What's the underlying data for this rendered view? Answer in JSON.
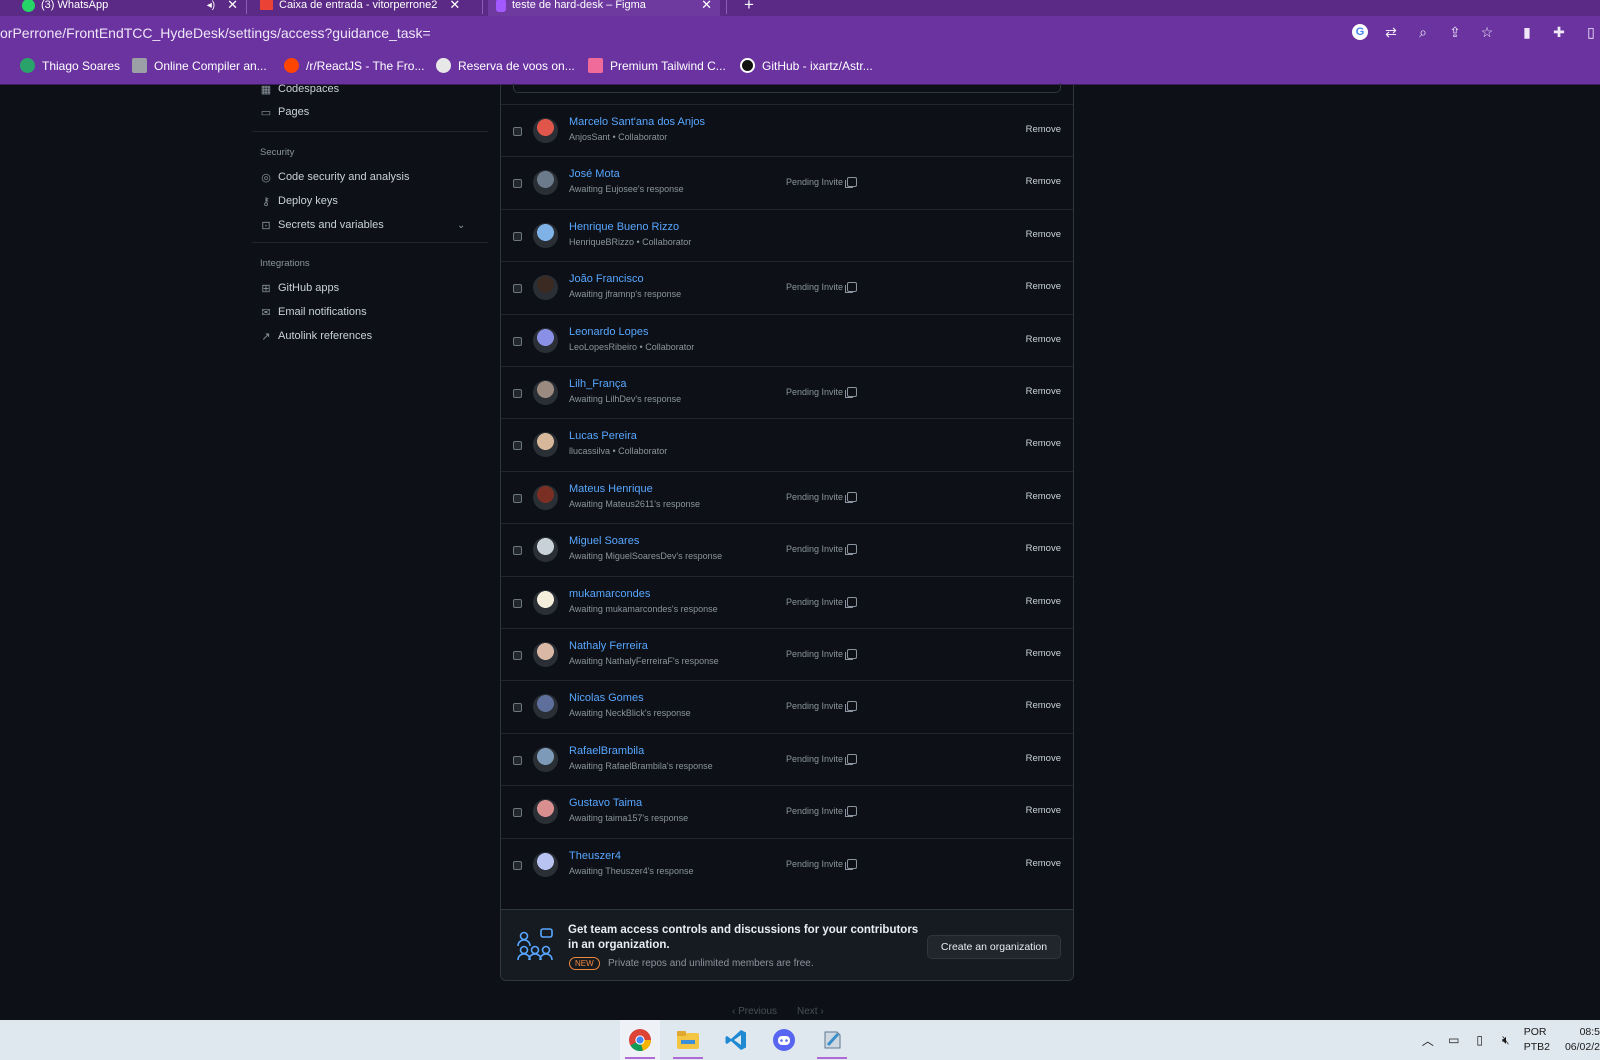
{
  "browser": {
    "tabs": [
      {
        "title": "(3) WhatsApp"
      },
      {
        "title": "Caixa de entrada - vitorperrone2"
      },
      {
        "title": "teste de hard-desk – Figma"
      }
    ],
    "url": "orPerrone/FrontEndTCC_HydeDesk/settings/access?guidance_task=",
    "bookmarks": [
      {
        "label": "Thiago Soares",
        "color": "#2aa36b"
      },
      {
        "label": "Online Compiler an...",
        "color": "#9aa0a6"
      },
      {
        "label": "/r/ReactJS - The Fro...",
        "color": "#ff4500"
      },
      {
        "label": "Reserva de voos on...",
        "color": "#e8e8e8"
      },
      {
        "label": "Premium Tailwind C...",
        "color": "#f06a9a"
      },
      {
        "label": "GitHub - ixartz/Astr...",
        "color": "#111111"
      }
    ]
  },
  "sidebar": {
    "top_items": [
      {
        "label": "Codespaces",
        "icon": "codespaces-icon"
      },
      {
        "label": "Pages",
        "icon": "browser-icon"
      }
    ],
    "security_heading": "Security",
    "security_items": [
      {
        "label": "Code security and analysis",
        "icon": "codescan-icon"
      },
      {
        "label": "Deploy keys",
        "icon": "key-icon"
      },
      {
        "label": "Secrets and variables",
        "icon": "asterisk-icon"
      }
    ],
    "integrations_heading": "Integrations",
    "integration_items": [
      {
        "label": "GitHub apps",
        "icon": "apps-icon"
      },
      {
        "label": "Email notifications",
        "icon": "mail-icon"
      },
      {
        "label": "Autolink references",
        "icon": "link-external-icon"
      }
    ]
  },
  "collaborators": {
    "pending_label": "Pending Invite",
    "remove_label": "Remove",
    "rows": [
      {
        "name": "Marcelo Sant'ana dos Anjos",
        "sub": "AnjosSant • Collaborator",
        "pending": false,
        "avatar": "#e0564a"
      },
      {
        "name": "José Mota",
        "sub": "Awaiting Eujosee's response",
        "pending": true,
        "avatar": "#6b7b8c"
      },
      {
        "name": "Henrique Bueno Rizzo",
        "sub": "HenriqueBRizzo • Collaborator",
        "pending": false,
        "avatar": "#7fb3e8"
      },
      {
        "name": "João Francisco",
        "sub": "Awaiting jframnp's response",
        "pending": true,
        "avatar": "#3a2a22"
      },
      {
        "name": "Leonardo Lopes",
        "sub": "LeoLopesRibeiro • Collaborator",
        "pending": false,
        "avatar": "#8a90e6"
      },
      {
        "name": "Lilh_França",
        "sub": "Awaiting LilhDev's response",
        "pending": true,
        "avatar": "#9a8a80"
      },
      {
        "name": "Lucas Pereira",
        "sub": "llucassilva • Collaborator",
        "pending": false,
        "avatar": "#d8b89a"
      },
      {
        "name": "Mateus Henrique",
        "sub": "Awaiting Mateus2611's response",
        "pending": true,
        "avatar": "#7a2f22"
      },
      {
        "name": "Miguel Soares",
        "sub": "Awaiting MiguelSoaresDev's response",
        "pending": true,
        "avatar": "#c8d0d8"
      },
      {
        "name": "mukamarcondes",
        "sub": "Awaiting mukamarcondes's response",
        "pending": true,
        "avatar": "#f3eedc"
      },
      {
        "name": "Nathaly Ferreira",
        "sub": "Awaiting NathalyFerreiraF's response",
        "pending": true,
        "avatar": "#d9b8a6"
      },
      {
        "name": "Nicolas Gomes",
        "sub": "Awaiting NeckBlick's response",
        "pending": true,
        "avatar": "#5d6f9a"
      },
      {
        "name": "RafaelBrambila",
        "sub": "Awaiting RafaelBrambila's response",
        "pending": true,
        "avatar": "#7d9bb8"
      },
      {
        "name": "Gustavo Taima",
        "sub": "Awaiting taima157's response",
        "pending": true,
        "avatar": "#d98f8f"
      },
      {
        "name": "Theuszer4",
        "sub": "Awaiting Theuszer4's response",
        "pending": true,
        "avatar": "#b9c3f2"
      }
    ]
  },
  "promo": {
    "title": "Get team access controls and discussions for your contributors in an organization.",
    "badge": "NEW",
    "text": "Private repos and unlimited members are free.",
    "button": "Create an organization"
  },
  "pagination": {
    "previous": "Previous",
    "next": "Next"
  },
  "taskbar": {
    "apps": [
      "chrome-icon",
      "file-explorer-icon",
      "vscode-icon",
      "discord-icon",
      "notepad-icon"
    ],
    "lang_top": "POR",
    "lang_bottom": "PTB2",
    "time": "08:5",
    "date": "06/02/2"
  }
}
